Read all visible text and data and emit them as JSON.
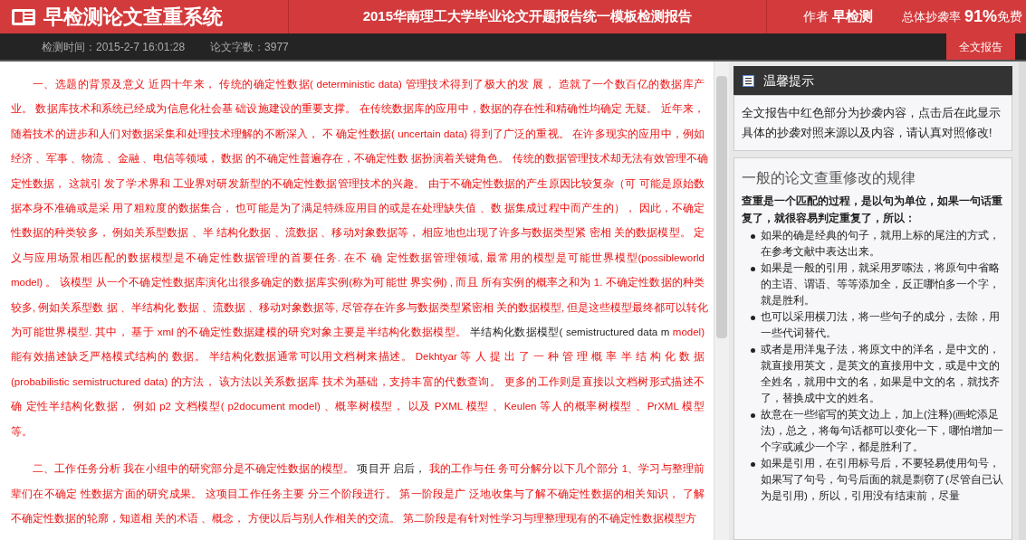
{
  "header": {
    "logo": "早检测论文查重系统",
    "report_title": "2015华南理工大学毕业论文开题报告统一模板检测报告",
    "author_label": "作者",
    "author": "早检测",
    "rate_label": "总体抄袭率",
    "rate": "91%",
    "edition": "免费"
  },
  "info_bar": {
    "check_time": "检测时间：2015-2-7 16:01:28",
    "word_count": "论文字数：3977",
    "button": "全文报告"
  },
  "paragraphs": [
    {
      "lines": [
        [
          {
            "text": "一、选题的背景及意义 近四十年来， 传统的确定性数据( deterministic data) 管理技术得到了极大的发 展， 造就了一个数百亿的数据库产",
            "copied": true
          }
        ],
        [
          {
            "text": "业。 数据库技术和系统已经成为信息化社会基 础设施建设的重要支撑。 在传统数据库的应用中，数据的存在性和精确性均确定 无疑。 近年来，",
            "copied": true
          }
        ],
        [
          {
            "text": "随着技术的进步和人们对数据采集和处理技术理解的不断深入， 不 确定性数据( uncertain data) 得到了广泛的重视。 在许多现实的应用中，例如",
            "copied": true
          }
        ],
        [
          {
            "text": "经济 、军事 、物流 、金融 、电信等领域， 数据 的不确定性普遍存在，不确定性数 据扮演着关键角色。 传统的数据管理技术却无法有效管理不确",
            "copied": true
          }
        ],
        [
          {
            "text": "定性数据， 这就引 发了学术界和 工业界对研发新型的不确定性数据管理技术的兴趣。 由于不确定性数据的产生原因比较复杂（可 可能是原始数",
            "copied": true
          }
        ],
        [
          {
            "text": "据本身不准确或是采 用了粗粒度的数据集合， 也可能是为了满足特殊应用目的或是在处理缺失值 、数 据集成过程中而产生的）， 因此，不确定",
            "copied": true
          }
        ],
        [
          {
            "text": "性数据的种类较多， 例如关系型数据 、半 结构化数据 、流数据 、移动对象数据等， 相应地也出现了许多与数据类型紧 密相 关的数据模型。 定",
            "copied": true
          }
        ],
        [
          {
            "text": "义与应用场景相匹配的数据模型是不确定性数据管理的首要任务. 在不 确 定性数据管理领域, 最常用的模型是可能世界模型(possibleworld",
            "copied": true
          }
        ],
        [
          {
            "text": "model) 。 该模型 从一个不确定性数据库演化出很多确定的数据库实例(称为可能世 界实例) , 而且 所有实例的概率之和为 1. 不确定性数据的种类",
            "copied": true
          }
        ],
        [
          {
            "text": "较多, 例如关系型数 据 、半结构化 数据 、流数据 、移动对象数据等, 尽管存在许多与数据类型紧密相 关的数据模型, 但是这些模型最终都可以转化",
            "copied": true
          }
        ],
        [
          {
            "text": "为可能世界模型. 其中， 基于 xml 的不确定性数据建模的研究对象主要是半结构化数据模型。 ",
            "copied": true
          },
          {
            "text": "半结构化数据模型( semistructured data m",
            "copied": false
          },
          {
            "text": " model)",
            "copied": true
          }
        ],
        [
          {
            "text": "能有效描述缺乏严格模式结构的 数据。 半结构化数据通常可以用文档树来描述。 Dekhtyar 等 人 提 出 了 一 种 管 理 概 率 半 结 构 化 数 据",
            "copied": true
          }
        ],
        [
          {
            "text": "(probabilistic semistructured data) 的方法， 该方法以关系数据库 技术为基础，支持丰富的代数查询。 更多的工作则是直接以文档树形式描述不",
            "copied": true
          }
        ],
        [
          {
            "text": "确 定性半结构化数据， 例如 p2 文档模型( p2document model) 、概率树模型， 以及 PXML 模型 、Keulen 等人的概率树模型 、PrXML 模型",
            "copied": true
          }
        ],
        [
          {
            "text": "等。",
            "copied": true
          }
        ]
      ]
    },
    {
      "lines": [
        [
          {
            "text": "二、工作任务分析 我在小组中的研究部分是不确定性数据的模型。 ",
            "copied": true
          },
          {
            "text": "项目开 启后，",
            "copied": false
          },
          {
            "text": " 我的工作与任 务可分解分以下几个部分 1、学习与整理前",
            "copied": true
          }
        ],
        [
          {
            "text": "辈们在不确定 性数据方面的研究成果。 这项目工作任务主要 分三个阶段进行。 第一阶段是广 泛地收集与了解不确定性数据的相关知识， 了解",
            "copied": true
          }
        ],
        [
          {
            "text": "不确定性数据的轮廓，知道相 关的术语 、概念， 方便以后与别人作相关的交流。 第二阶段是有针对性学习与理整理现有的不确定性数据模型方",
            "copied": true
          }
        ]
      ]
    }
  ],
  "tips": {
    "title": "温馨提示",
    "notice": "全文报告中红色部分为抄袭内容，点击后在此显示具体的抄袭对照来源以及内容，请认真对照修改!"
  },
  "rules": {
    "title": "一般的论文查重修改的规律",
    "intro": "查重是一个匹配的过程，是以句为单位，如果一句话重复了，就很容易判定重复了，所以：",
    "items": [
      "如果的确是经典的句子，就用上标的尾注的方式，在参考文献中表达出来。",
      "如果是一般的引用，就采用罗嗦法，将原句中省略的主语、谓语、等等添加全，反正哪怕多一个字，就是胜利。",
      "也可以采用横刀法，将一些句子的成分，去除，用一些代词替代。",
      "或者是用洋鬼子法，将原文中的洋名，是中文的，就直接用英文，是英文的直接用中文，或是中文的全姓名，就用中文的名，如果是中文的名，就找齐了，替换成中文的姓名。",
      "故意在一些缩写的英文边上，加上(注释)(画蛇添足法)，总之，将每句话都可以变化一下，哪怕增加一个字或减少一个字，都是胜利了。",
      "如果是引用，在引用标号后，不要轻易使用句号，如果写了句号，句号后面的就是剽窃了(尽管自已认为是引用)，所以，引用没有结束前，尽量"
    ]
  }
}
